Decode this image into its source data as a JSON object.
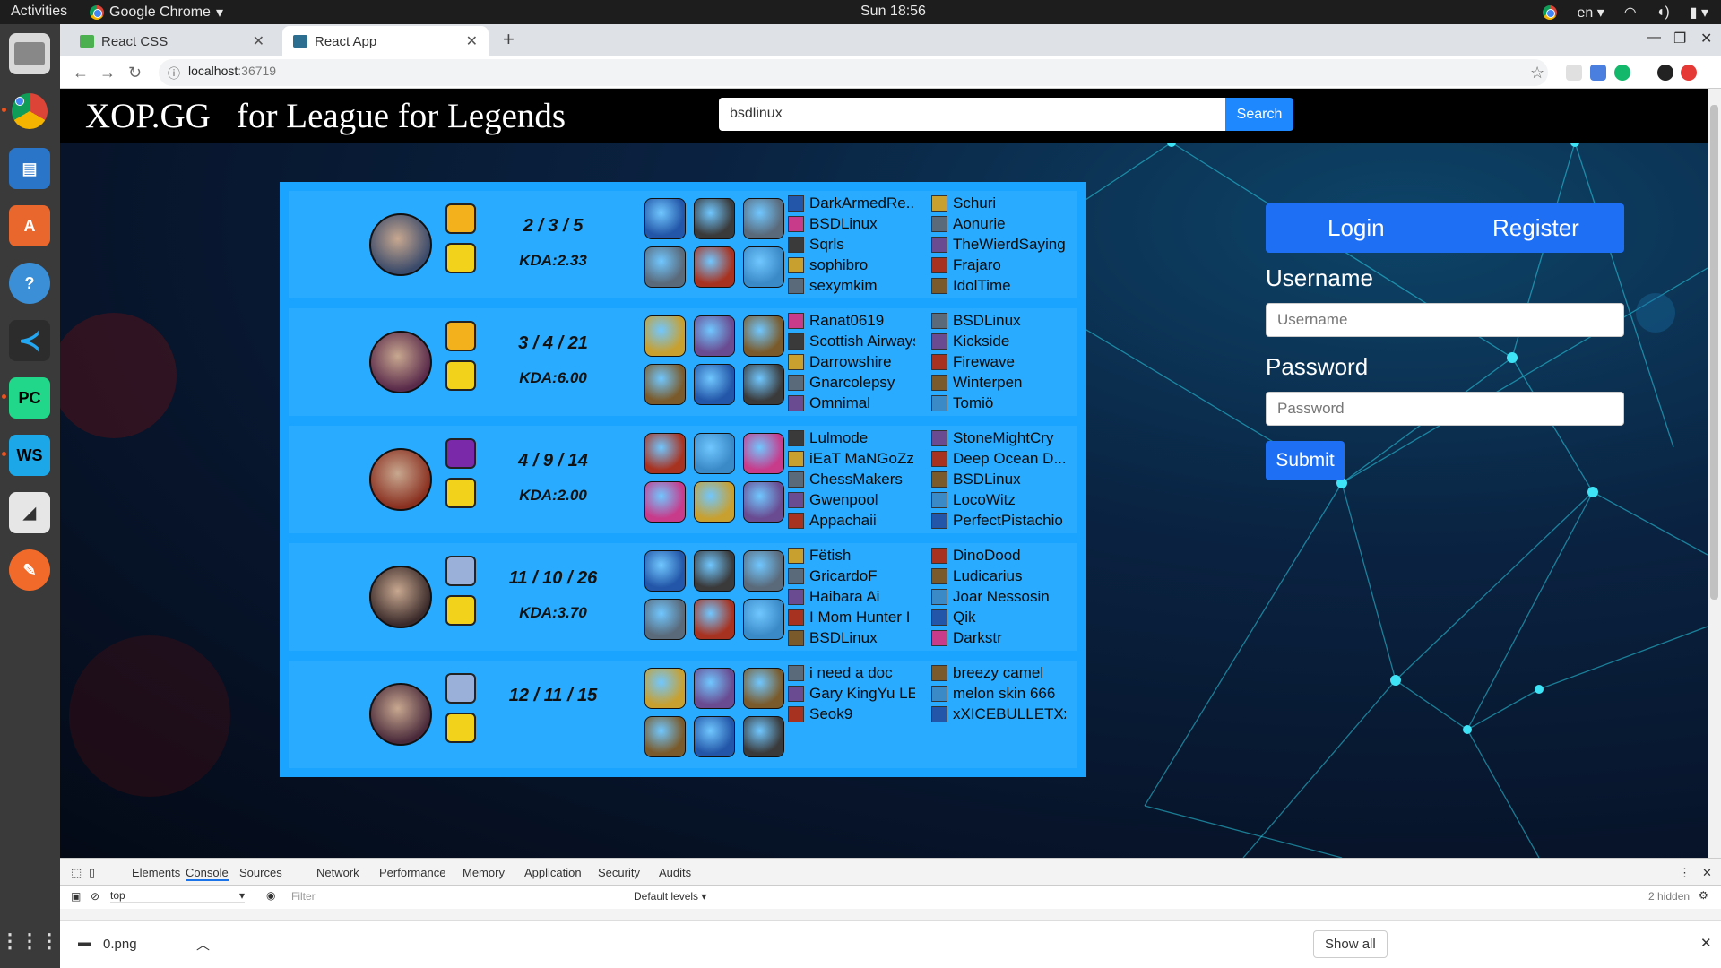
{
  "system": {
    "activities": "Activities",
    "app_name": "Google Chrome",
    "clock": "Sun 18:56",
    "lang": "en"
  },
  "browser": {
    "tabs": [
      {
        "title": "React CSS"
      },
      {
        "title": "React App"
      }
    ],
    "url_host": "localhost",
    "url_port": ":36719"
  },
  "header": {
    "logo": "XOP.GG   for League for Legends",
    "search_value": "bsdlinux",
    "search_button": "Search"
  },
  "matches": [
    {
      "score": "2 / 3 / 5",
      "kda": "KDA:2.33",
      "team_a": [
        "DarkArmedRe...",
        "BSDLinux",
        "Sqrls",
        "sophibro",
        "sexymkim"
      ],
      "team_b": [
        "Schuri",
        "Aonurie",
        "TheWierdSaying",
        "Frajaro",
        "IdolTime"
      ]
    },
    {
      "score": "3 / 4 / 21",
      "kda": "KDA:6.00",
      "team_a": [
        "Ranat0619",
        "Scottish Airways",
        "Darrowshire",
        "Gnarcolepsy",
        "Omnimal"
      ],
      "team_b": [
        "BSDLinux",
        "Kickside",
        "Firewave",
        "Winterpen",
        "Tomiö"
      ]
    },
    {
      "score": "4 / 9 / 14",
      "kda": "KDA:2.00",
      "team_a": [
        "Lulmode",
        "iEaT MaNGoZz",
        "ChessMakers",
        "Gwenpool",
        "Appachaii"
      ],
      "team_b": [
        "StoneMightCry",
        "Deep Ocean D...",
        "BSDLinux",
        "LocoWitz",
        "PerfectPistachio"
      ]
    },
    {
      "score": "11 / 10 / 26",
      "kda": "KDA:3.70",
      "team_a": [
        "Fëtish",
        "GricardoF",
        "Haibara Ai",
        "I Mom Hunter I",
        "BSDLinux"
      ],
      "team_b": [
        "DinoDood",
        "Ludicarius",
        "Joar Nessosin",
        "Qik",
        "Darkstr"
      ]
    },
    {
      "score": "12 / 11 / 15",
      "kda": "",
      "team_a": [
        "i need a doc",
        "Gary KingYu LEE",
        "Seok9"
      ],
      "team_b": [
        "breezy camel",
        "melon skin 666",
        "xXICEBULLETXx"
      ]
    }
  ],
  "auth": {
    "login_tab": "Login",
    "register_tab": "Register",
    "username_label": "Username",
    "username_placeholder": "Username",
    "password_label": "Password",
    "password_placeholder": "Password",
    "submit": "Submit"
  },
  "devtools": {
    "tabs": [
      "Elements",
      "Console",
      "Sources",
      "Network",
      "Performance",
      "Memory",
      "Application",
      "Security",
      "Audits"
    ],
    "context": "top",
    "filter_placeholder": "Filter",
    "levels": "Default levels ▾",
    "hidden": "2 hidden"
  },
  "downloads": {
    "file": "0.png",
    "show_all": "Show all"
  },
  "colors": {
    "card": "#1aa3ff",
    "accent": "#1f6ff5",
    "header": "#000000"
  }
}
